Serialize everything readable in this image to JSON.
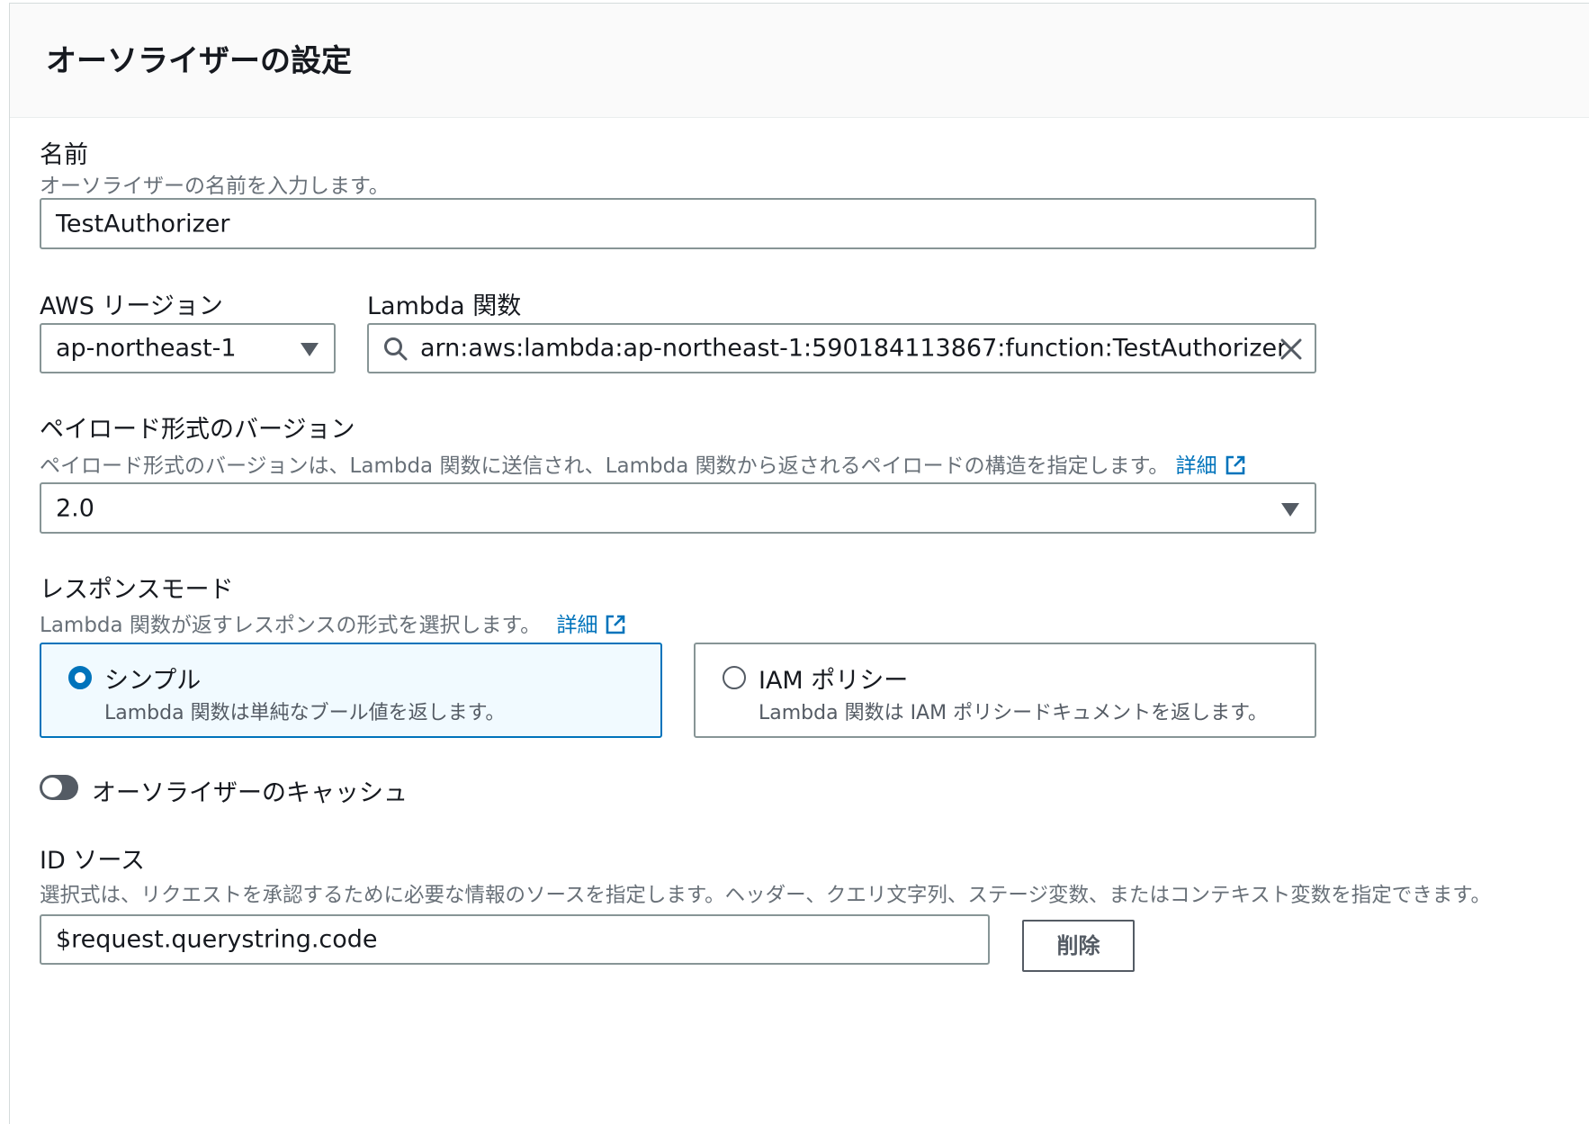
{
  "panel": {
    "title": "オーソライザーの設定"
  },
  "name": {
    "label": "名前",
    "description": "オーソライザーの名前を入力します。",
    "value": "TestAuthorizer"
  },
  "region": {
    "label": "AWS リージョン",
    "value": "ap-northeast-1"
  },
  "lambda_function": {
    "label": "Lambda 関数",
    "value": "arn:aws:lambda:ap-northeast-1:590184113867:function:TestAuthorizer"
  },
  "payload_version": {
    "label": "ペイロード形式のバージョン",
    "description": "ペイロード形式のバージョンは、Lambda 関数に送信され、Lambda 関数から返されるペイロードの構造を指定します。",
    "link": "詳細",
    "value": "2.0"
  },
  "response_mode": {
    "label": "レスポンスモード",
    "description": "Lambda 関数が返すレスポンスの形式を選択します。",
    "link": "詳細",
    "options": [
      {
        "title": "シンプル",
        "description": "Lambda 関数は単純なブール値を返します。",
        "selected": true
      },
      {
        "title": "IAM ポリシー",
        "description": "Lambda 関数は IAM ポリシードキュメントを返します。",
        "selected": false
      }
    ]
  },
  "cache": {
    "label": "オーソライザーのキャッシュ",
    "enabled": false
  },
  "identity_source": {
    "label": "ID ソース",
    "description": "選択式は、リクエストを承認するために必要な情報のソースを指定します。ヘッダー、クエリ文字列、ステージ変数、またはコンテキスト変数を指定できます。",
    "value": "$request.querystring.code",
    "remove_label": "削除"
  },
  "colors": {
    "accent": "#0073bb",
    "border": "#879596",
    "selected_bg": "#f1faff"
  }
}
